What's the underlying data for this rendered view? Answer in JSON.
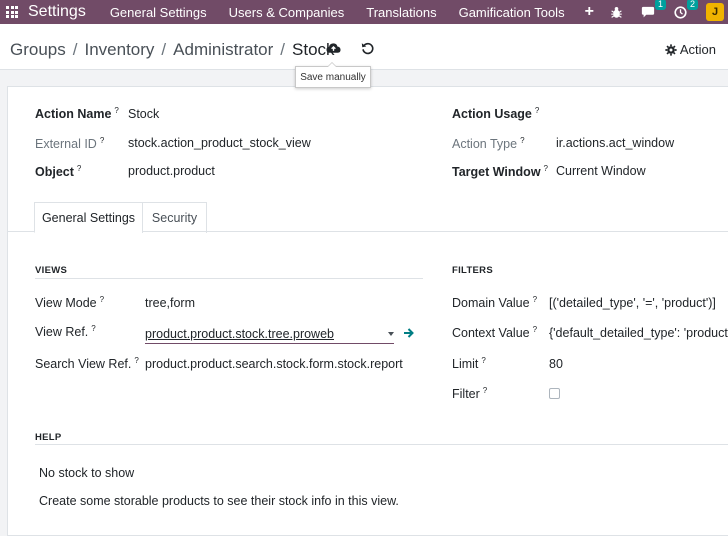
{
  "navbar": {
    "app_name": "Settings",
    "menu": [
      "General Settings",
      "Users & Companies",
      "Translations",
      "Gamification Tools"
    ],
    "plus_icon": "plus-icon",
    "messages_badge": "1",
    "activity_badge": "2",
    "avatar_letter": "J",
    "bg_color": "#714b67"
  },
  "breadcrumb": {
    "items": [
      "Groups",
      "Inventory",
      "Administrator"
    ],
    "current": "Stock",
    "separator": "/"
  },
  "control_panel": {
    "save_tooltip": "Save manually",
    "action_label": "Action"
  },
  "form": {
    "action_name": {
      "label": "Action Name",
      "value": "Stock"
    },
    "external_id": {
      "label": "External ID",
      "value": "stock.action_product_stock_view"
    },
    "object": {
      "label": "Object",
      "value": "product.product"
    },
    "action_usage": {
      "label": "Action Usage"
    },
    "action_type": {
      "label": "Action Type",
      "value": "ir.actions.act_window"
    },
    "target_window": {
      "label": "Target Window",
      "value": "Current Window"
    },
    "help_marker": "?"
  },
  "tabs": [
    "General Settings",
    "Security"
  ],
  "views": {
    "title": "VIEWS",
    "view_mode": {
      "label": "View Mode",
      "value": "tree,form"
    },
    "view_ref": {
      "label": "View Ref.",
      "value": "product.product.stock.tree.proweb"
    },
    "search_view_ref": {
      "label": "Search View Ref.",
      "value": "product.product.search.stock.form.stock.report"
    }
  },
  "filters": {
    "title": "FILTERS",
    "domain_value": {
      "label": "Domain Value",
      "value": "[('detailed_type', '=', 'product')]"
    },
    "context_value": {
      "label": "Context Value",
      "value": "{'default_detailed_type': 'product'}"
    },
    "limit": {
      "label": "Limit",
      "value": "80"
    },
    "filter": {
      "label": "Filter",
      "checked": false
    }
  },
  "help": {
    "title": "HELP",
    "line1": "No stock to show",
    "line2": "Create some storable products to see their stock info in this view."
  }
}
